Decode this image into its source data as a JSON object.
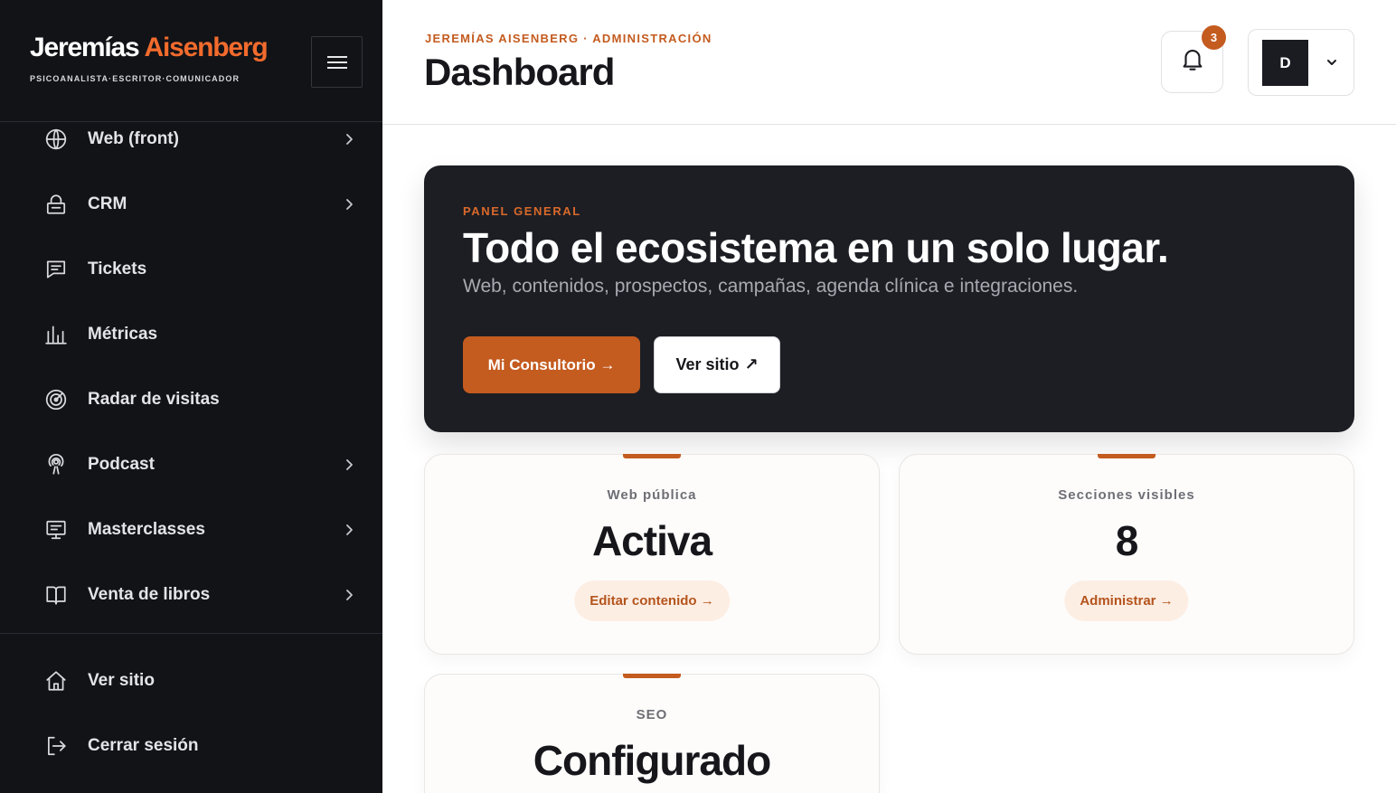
{
  "sidebar": {
    "brand_first": "Jeremías",
    "brand_last": "Aisenberg",
    "brand_tagline": "PSICOANALISTA·ESCRITOR·COMUNICADOR",
    "menu_icon": "hamburger-icon",
    "items": [
      {
        "label": "Web (front)",
        "icon": "globe-icon",
        "has_chevron": true
      },
      {
        "label": "CRM",
        "icon": "lock-icon",
        "has_chevron": true
      },
      {
        "label": "Tickets",
        "icon": "message-icon",
        "has_chevron": false
      },
      {
        "label": "Métricas",
        "icon": "bar-chart-icon",
        "has_chevron": false
      },
      {
        "label": "Radar de visitas",
        "icon": "radar-icon",
        "has_chevron": false
      },
      {
        "label": "Podcast",
        "icon": "podcast-icon",
        "has_chevron": true
      },
      {
        "label": "Masterclasses",
        "icon": "presentation-icon",
        "has_chevron": true
      },
      {
        "label": "Venta de libros",
        "icon": "book-icon",
        "has_chevron": true
      }
    ],
    "footer_items": [
      {
        "label": "Ver sitio",
        "icon": "home-icon"
      },
      {
        "label": "Cerrar sesión",
        "icon": "logout-icon"
      }
    ]
  },
  "header": {
    "breadcrumb": "JEREMÍAS AISENBERG · ADMINISTRACIÓN",
    "title": "Dashboard",
    "notification_count": "3",
    "avatar_initial": "D"
  },
  "hero": {
    "eyebrow": "PANEL GENERAL",
    "title": "Todo el ecosistema en un solo lugar.",
    "subtitle": "Web, contenidos, prospectos, campañas, agenda clínica e integraciones.",
    "primary_label": "Mi Consultorio →",
    "secondary_label": "Ver sitio",
    "secondary_icon": "↗"
  },
  "cards": [
    {
      "label": "Web pública",
      "value": "Activa",
      "action": "Editar contenido →"
    },
    {
      "label": "Secciones visibles",
      "value": "8",
      "action": "Administrar →"
    },
    {
      "label": "SEO",
      "value": "Configurado",
      "action": ""
    }
  ],
  "colors": {
    "accent": "#c45b1f",
    "brand_accent": "#f26b2d",
    "sidebar_bg": "#121317",
    "hero_bg": "#1d1e24"
  }
}
